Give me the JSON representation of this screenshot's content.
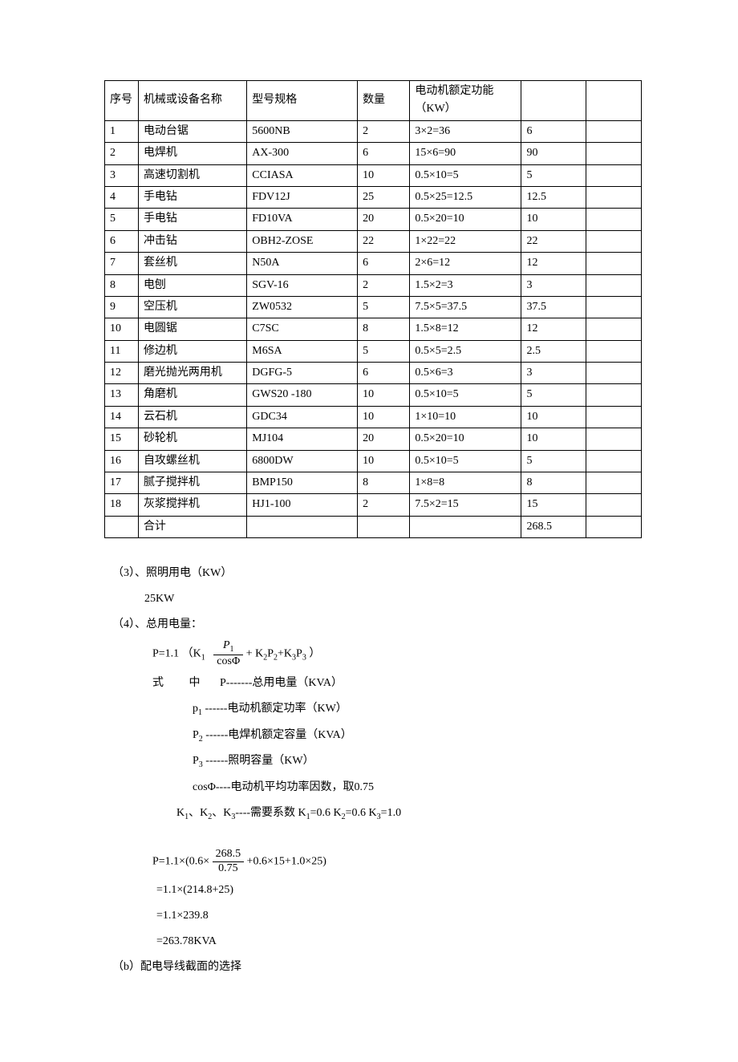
{
  "table": {
    "headers": [
      "序号",
      "机械或设备名称",
      "型号规格",
      "数量",
      "电动机额定功能（KW）",
      "",
      ""
    ],
    "rows": [
      [
        "1",
        "电动台锯",
        "5600NB",
        "2",
        "3×2=36",
        "6",
        ""
      ],
      [
        "2",
        "电焊机",
        "AX-300",
        "6",
        "15×6=90",
        "90",
        ""
      ],
      [
        "3",
        "高速切割机",
        "CCIASA",
        "10",
        "0.5×10=5",
        "5",
        ""
      ],
      [
        "4",
        "手电钻",
        "FDV12J",
        "25",
        "0.5×25=12.5",
        "12.5",
        ""
      ],
      [
        "5",
        "手电钻",
        "FD10VA",
        "20",
        "0.5×20=10",
        "10",
        ""
      ],
      [
        "6",
        "冲击钻",
        "OBH2-ZOSE",
        "22",
        "1×22=22",
        "22",
        ""
      ],
      [
        "7",
        "套丝机",
        "N50A",
        "6",
        "2×6=12",
        "12",
        ""
      ],
      [
        "8",
        "电刨",
        "SGV-16",
        "2",
        "1.5×2=3",
        "3",
        ""
      ],
      [
        "9",
        "空压机",
        "ZW0532",
        "5",
        "7.5×5=37.5",
        "37.5",
        ""
      ],
      [
        "10",
        "电圆锯",
        "C7SC",
        "8",
        "1.5×8=12",
        "12",
        ""
      ],
      [
        "11",
        "修边机",
        "M6SA",
        "5",
        "0.5×5=2.5",
        "2.5",
        ""
      ],
      [
        "12",
        "磨光抛光两用机",
        "DGFG-5",
        "6",
        "0.5×6=3",
        "3",
        ""
      ],
      [
        "13",
        "角磨机",
        "GWS20 -180",
        "10",
        "0.5×10=5",
        "5",
        ""
      ],
      [
        "14",
        "云石机",
        "GDC34",
        "10",
        "1×10=10",
        "10",
        ""
      ],
      [
        "15",
        "砂轮机",
        "MJ104",
        "20",
        "0.5×20=10",
        "10",
        ""
      ],
      [
        "16",
        "自攻螺丝机",
        "6800DW",
        "10",
        "0.5×10=5",
        "5",
        ""
      ],
      [
        "17",
        "腻子搅拌机",
        "BMP150",
        "8",
        "1×8=8",
        "8",
        ""
      ],
      [
        "18",
        "灰浆搅拌机",
        "HJ1-100",
        "2",
        "7.5×2=15",
        "15",
        ""
      ],
      [
        "",
        "合计",
        "",
        "",
        "",
        "268.5",
        ""
      ]
    ]
  },
  "section3": {
    "title": "（3）、照明用电（KW）",
    "value": "25KW"
  },
  "section4": {
    "title": "（4）、总用电量：",
    "formula_lhs": "P=1.1 （K",
    "formula_k1_rhs": " + K",
    "formula_tail": "   ）",
    "frac_num": "P",
    "frac_den": "cosΦ",
    "shi": "式",
    "zhong": "中",
    "p_desc": "P-------总用电量（KVA）",
    "p1_desc": " ------电动机额定功率（KW）",
    "p2_desc": " ------电焊机额定容量（KVA）",
    "p3_desc": " ------照明容量（KW）",
    "cos_desc": "cosΦ----电动机平均功率因数，取0.75",
    "k_desc_a": "、K",
    "k_desc_b": "----需要系数    K",
    "k_vals": "=0.6 K",
    "k2_val": "=0.6   K",
    "k3_val": "=1.0"
  },
  "calc": {
    "line1_a": "P=1.1×(0.6× ",
    "line1_frac_num": "268.5",
    "line1_frac_den": "0.75",
    "line1_b": " +0.6×15+1.0×25)",
    "line2": " =1.1×(214.8+25)",
    "line3": " =1.1×239.8",
    "line4": " =263.78KVA"
  },
  "section_b": "（b）配电导线截面的选择"
}
